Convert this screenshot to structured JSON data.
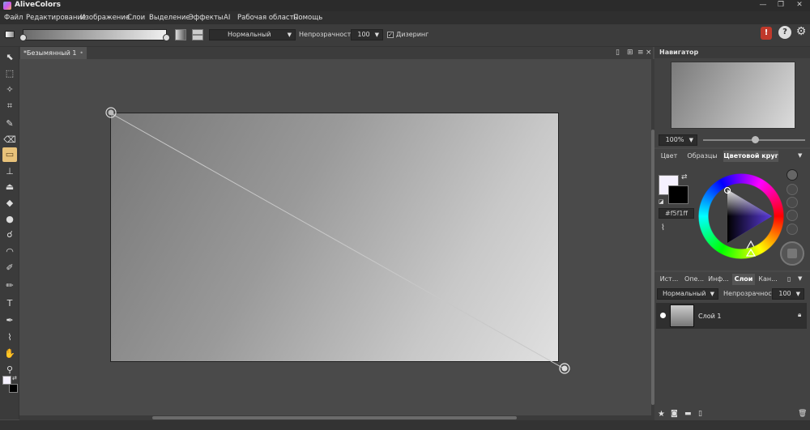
{
  "app": {
    "title": "AliveColors",
    "minimize": "—",
    "restore": "❐",
    "close": "✕"
  },
  "menu": [
    "Файл",
    "Редактирование",
    "Изображение",
    "Слои",
    "Выделение",
    "Эффекты",
    "AI",
    "Рабочая область",
    "Помощь"
  ],
  "options": {
    "blend_mode": "Нормальный",
    "opacity_label": "Непрозрачность",
    "opacity_value": "100",
    "dither_label": "Дизеринг",
    "dither_checked": "✓"
  },
  "document": {
    "tab_label": "*Безымянный 1",
    "tab_close": "•"
  },
  "tools": [
    {
      "name": "move-tool",
      "glyph": "⬉"
    },
    {
      "name": "marquee-tool",
      "glyph": "⬚"
    },
    {
      "name": "magic-wand-tool",
      "glyph": "✧"
    },
    {
      "name": "crop-tool",
      "glyph": "⌗"
    },
    {
      "name": "brush-tool",
      "glyph": "✎"
    },
    {
      "name": "eraser-tool",
      "glyph": "⌫"
    },
    {
      "name": "gradient-tool",
      "glyph": "▭"
    },
    {
      "name": "stamp-tool",
      "glyph": "⊥"
    },
    {
      "name": "bucket-tool",
      "glyph": "⏏"
    },
    {
      "name": "blur-tool",
      "glyph": "◆"
    },
    {
      "name": "dodge-tool",
      "glyph": "●"
    },
    {
      "name": "smudge-tool",
      "glyph": "☌"
    },
    {
      "name": "wave-tool",
      "glyph": "◠"
    },
    {
      "name": "fx-brush-tool",
      "glyph": "✐"
    },
    {
      "name": "pencil-tool",
      "glyph": "✏"
    },
    {
      "name": "text-tool",
      "glyph": "T"
    },
    {
      "name": "pen-tool",
      "glyph": "✒"
    },
    {
      "name": "eyedropper-tool",
      "glyph": "⌇"
    },
    {
      "name": "hand-tool",
      "glyph": "✋"
    },
    {
      "name": "zoom-tool",
      "glyph": "⚲"
    }
  ],
  "navigator": {
    "title": "Навигатор",
    "zoom": "100%"
  },
  "color_panel": {
    "tabs": [
      "Цвет",
      "Образцы",
      "Цветовой круг"
    ],
    "hex": "#f5f1ff",
    "foreground": "#f5f1ff",
    "background": "#000000"
  },
  "layers_panel": {
    "tabs": [
      "Ист...",
      "Опе...",
      "Инф...",
      "Слои",
      "Кан..."
    ],
    "blend_mode": "Нормальный",
    "opacity_label": "Непрозрачность",
    "opacity_value": "100",
    "layers": [
      {
        "name": "Слой 1"
      }
    ]
  },
  "colors": {
    "accent": "#c0392b",
    "wheel_triangle": "#5a3adb"
  }
}
